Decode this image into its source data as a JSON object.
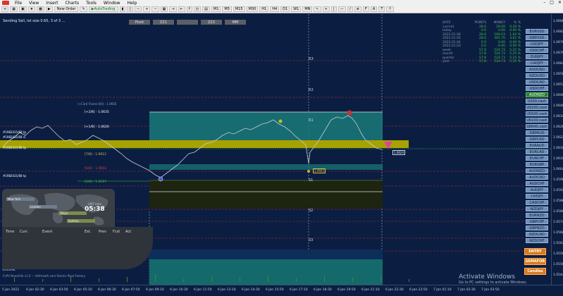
{
  "menu": {
    "items": [
      "File",
      "View",
      "Insert",
      "Charts",
      "Tools",
      "Window",
      "Help"
    ]
  },
  "toolbar": {
    "new_order": "New Order",
    "autotrading": "AutoTrading",
    "timeframes": [
      "M1",
      "M5",
      "M15",
      "M30",
      "H1",
      "H4",
      "D1",
      "W1",
      "MN"
    ]
  },
  "chart_title": "Sending Sell, lot size 0.65, 3 of 3 ...",
  "zone_tabs": [
    "Pivot",
    "Z21",
    "",
    "Z23",
    "MM"
  ],
  "stats": {
    "header": [
      "DATE",
      "POINTS",
      "MONEY",
      "% %"
    ],
    "rows": [
      [
        "current",
        "28.6",
        "29.09",
        "0.29 %"
      ],
      [
        "today",
        "0.0",
        "0.00",
        "0.00 %"
      ],
      [
        "2022.01.06",
        "28.6",
        "164.03",
        "1.64 %"
      ],
      [
        "2022.01.05",
        "28.6",
        "365.70",
        "3.61 %"
      ],
      [
        "2022.01.04",
        "0.0",
        "0.00",
        "0.00 %"
      ],
      [
        "2022.01.03",
        "0.0",
        "-0.00",
        "0.00 %"
      ],
      [
        "week",
        "57.8",
        "524.73",
        "5.25 %"
      ],
      [
        "month",
        "57.8",
        "524.73",
        "5.25 %"
      ],
      [
        "quarter",
        "57.8",
        "524.73",
        "5.25 %"
      ],
      [
        "year",
        "57.8",
        "524.73",
        "5.25 %"
      ]
    ]
  },
  "symbols": [
    "EURUSD",
    "GBPUSD",
    "USDJPY",
    "USDCHF",
    "EURJPY",
    "CADJPY",
    "AUDUSD",
    "NZDUSD",
    "USDCAD",
    "USDCHF",
    "AUDNZD",
    "US30.cash",
    "US100.cash",
    "US500.cash",
    "UK100.cash",
    "GER40.cash",
    "GBPAUD",
    "GBPCAD",
    "EURAUD",
    "EURCAD",
    "EURCHF",
    "EURGBP",
    "AUDNZD",
    "AUDCAD",
    "AUDCHF",
    "AUDJPY",
    "CHFJPY",
    "CADCHF",
    "NZDJPY",
    "EURNZD",
    "GBPCHF",
    "GBPNZD",
    "NZDCAD",
    "NZDCHF"
  ],
  "active_symbol_index": 10,
  "levels": {
    "r3": "R3",
    "r2": "R2",
    "r1": "R1",
    "s1": "S1",
    "s2": "S2",
    "s3": "S3",
    "l1": "[+2/8] - 1.0635",
    "l2": "[+1/8] - 1.0626",
    "l3": "[7/8] - 1.0612",
    "l4": "[6/8] - 1.0603",
    "l5": "[5/8] - 1.0597",
    "small1": "1.0624",
    "small2": "1.0603",
    "left1": "#1982421/68 tp",
    "left2": "#1982421/68 sl",
    "left3": "#1982421/68 tp",
    "left4": "#1982421/68 tp",
    "crst": "(+C3rd Frame 0/0) : 1.0656"
  },
  "price_axis": [
    "1.0688",
    "1.0682",
    "1.0676",
    "1.0670",
    "1.0664",
    "1.0658",
    "1.0652",
    "1.0646",
    "1.0640",
    "1.0634",
    "1.0628",
    "1.0622",
    "1.0616",
    "1.0610",
    "1.0604",
    "1.0598",
    "1.0592",
    "1.0586",
    "1.0580",
    "1.0574",
    "1.0568",
    "1.0562",
    "1.0556",
    "1.0550",
    "1.0544"
  ],
  "time_axis": [
    "5 Jan 2022",
    "6 Jan 02:30",
    "6 Jan 03:50",
    "6 Jan 05:10",
    "6 Jan 06:30",
    "6 Jan 07:50",
    "6 Jan 09:10",
    "6 Jan 10:30",
    "6 Jan 11:50",
    "6 Jan 13:10",
    "6 Jan 14:30",
    "6 Jan 15:50",
    "6 Jan 17:10",
    "6 Jan 18:30",
    "6 Jan 19:50",
    "6 Jan 21:10",
    "6 Jan 22:30",
    "6 Jan 23:50",
    "7 Jan 01:10",
    "7 Jan 02:30",
    "7 Jan 03:50"
  ],
  "world": {
    "cities": [
      "New York",
      "London",
      "Tokyo",
      "Sydney"
    ],
    "clock_time": "05:38",
    "clock_label": "GMT time",
    "news_header": [
      "Time",
      "Curr.",
      "Event",
      "Est.",
      "Prev",
      "Fcst",
      "Act"
    ]
  },
  "actions": {
    "entry": "ENTRY",
    "semafor": "SEMAFOR",
    "candles": "Candles"
  },
  "watermark": {
    "title": "Activate Windows",
    "sub": "Go to PC settings to activate Windows."
  },
  "footer": "FxPV NewsInfo v1.0  —  defmaeth.com     Starter Pivot Factory",
  "colors": {
    "bg": "#0b1e42",
    "yellow_band": "#b8b000",
    "teal_zone": "#1a7a7a",
    "candle": "#c8ccd2"
  }
}
